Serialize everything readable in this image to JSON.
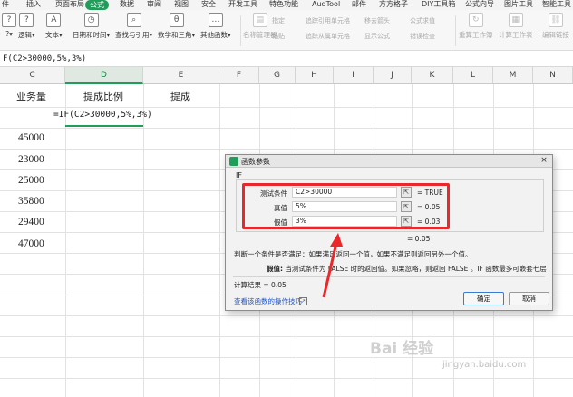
{
  "menu": {
    "items": [
      "件",
      "插入",
      "页面布局",
      "公式",
      "数据",
      "审阅",
      "视图",
      "安全",
      "开发工具",
      "特色功能",
      "AudTool",
      "邮件",
      "方方格子",
      "DIY工具箱",
      "公式向导",
      "图片工具",
      "智能工具"
    ],
    "active_index": 3
  },
  "toolbar": {
    "tools": [
      {
        "label": "?▾",
        "icon": "question-icon",
        "enabled": true
      },
      {
        "label": "逻辑▾",
        "icon": "logic-icon",
        "enabled": true
      },
      {
        "label": "文本▾",
        "icon": "text-icon",
        "enabled": true
      },
      {
        "label": "日期和时间▾",
        "icon": "calendar-icon",
        "enabled": true
      },
      {
        "label": "查找与引用▾",
        "icon": "lookup-icon",
        "enabled": true
      },
      {
        "label": "数学和三角▾",
        "icon": "math-icon",
        "enabled": true
      },
      {
        "label": "其他函数▾",
        "icon": "more-functions-icon",
        "enabled": true
      },
      {
        "label": "名称管理器",
        "icon": "name-manager-icon",
        "enabled": false
      },
      {
        "label": "重算工作簿",
        "icon": "recalc-workbook-icon",
        "enabled": false
      },
      {
        "label": "计算工作表",
        "icon": "calc-sheet-icon",
        "enabled": false
      },
      {
        "label": "编辑链接",
        "icon": "edit-links-icon",
        "enabled": false
      }
    ],
    "minis": [
      "指定",
      "粘贴",
      "追踪引用单元格",
      "追踪从属单元格",
      "移去箭头",
      "显示公式",
      "公式求值",
      "错误检查"
    ]
  },
  "formula_bar": {
    "text": "F(C2>30000,5%,3%)"
  },
  "columns": {
    "letters": [
      "C",
      "D",
      "E",
      "F",
      "G",
      "H",
      "I",
      "J",
      "K",
      "L",
      "M",
      "N"
    ],
    "selected": "D"
  },
  "sheet": {
    "headers": {
      "c": "业务量",
      "d": "提成比例",
      "e": "提成"
    },
    "edit_formula": "=IF(C2>30000,5%,3%)",
    "values": [
      "45000",
      "23000",
      "25000",
      "35800",
      "29400",
      "47000"
    ]
  },
  "dialog": {
    "title": "函数参数",
    "close": "×",
    "function_name": "IF",
    "args": [
      {
        "label": "测试条件",
        "value": "C2>30000",
        "result": "= TRUE"
      },
      {
        "label": "真值",
        "value": "5%",
        "result": "= 0.05"
      },
      {
        "label": "假值",
        "value": "3%",
        "result": "= 0.03"
      }
    ],
    "pick_icon": "range-picker-icon",
    "formula_result": "= 0.05",
    "description": "判断一个条件是否满足：如果满足返回一个值，如果不满足则返回另外一个值。",
    "arg_help_label": "假值:",
    "arg_help": "当测试条件为 FALSE 时的返回值。如果忽略，则返回 FALSE 。IF 函数最多可嵌套七层",
    "calc_result": "计算结果 = 0.05",
    "help_link": "查看该函数的操作技巧",
    "ok": "确定",
    "cancel": "取消"
  },
  "colors": {
    "accent": "#1f9e5a",
    "highlight": "#e8282b",
    "link": "#2156c4"
  },
  "watermark": {
    "main": "Bai 经验",
    "sub": "jingyan.baidu.com"
  }
}
